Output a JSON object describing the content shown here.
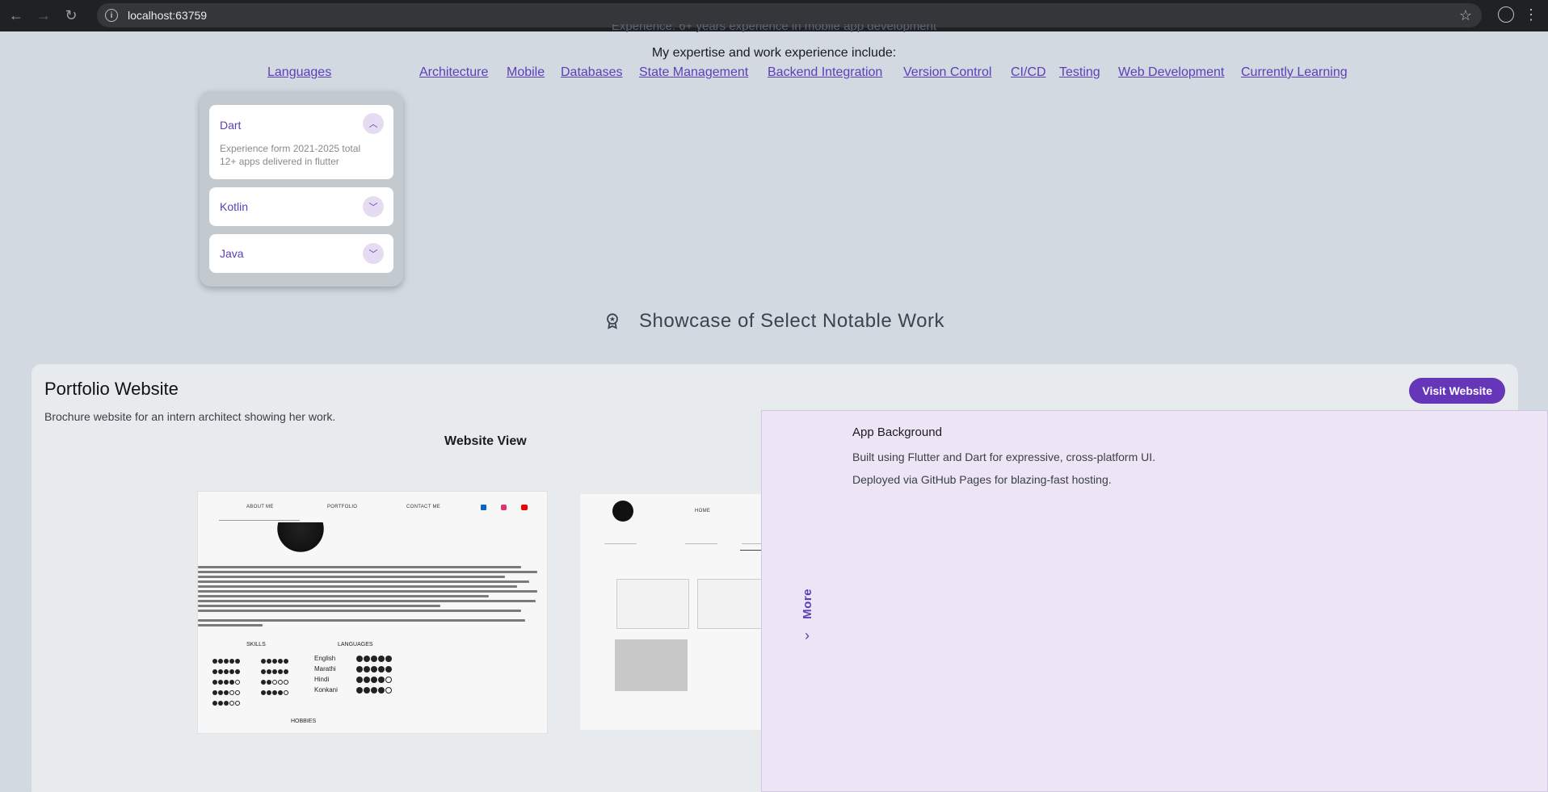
{
  "browser": {
    "url": "localhost:63759"
  },
  "intro": {
    "experience_line": "Experience: 6+ years experience in mobile app development",
    "expertise_heading": "My expertise and work experience include:"
  },
  "skills_tabs": [
    "Languages",
    "Architecture",
    "Mobile",
    "Databases",
    "State Management",
    "Backend Integration",
    "Version Control",
    "CI/CD",
    "Testing",
    "Web Development",
    "Currently Learning"
  ],
  "languages": [
    {
      "name": "Dart",
      "expanded": true,
      "details": [
        "Experience form 2021-2025 total",
        "12+ apps delivered in flutter"
      ]
    },
    {
      "name": "Kotlin",
      "expanded": false
    },
    {
      "name": "Java",
      "expanded": false
    }
  ],
  "showcase": {
    "heading": "Showcase of Select Notable Work",
    "icon": "medal-icon"
  },
  "project": {
    "title": "Portfolio Website",
    "description": "Brochure website for an intern architect showing her work.",
    "visit_label": "Visit Website",
    "website_view_label": "Website View",
    "preview1": {
      "nav": [
        "ABOUT ME",
        "PORTFOLIO",
        "CONTACT ME"
      ],
      "skills_label": "SKILLS",
      "languages_label": "LANGUAGES",
      "hobbies_label": "HOBBIES",
      "languages": [
        {
          "name": "English",
          "level": 5
        },
        {
          "name": "Marathi",
          "level": 5
        },
        {
          "name": "Hindi",
          "level": 4
        },
        {
          "name": "Konkani",
          "level": 4
        }
      ]
    },
    "preview2": {
      "nav": [
        "HOME"
      ]
    }
  },
  "side_panel": {
    "more_label": "More",
    "heading": "App Background",
    "line1": "Built using Flutter and Dart for expressive, cross-platform UI.",
    "line2": "Deployed via GitHub Pages for blazing-fast hosting."
  },
  "colors": {
    "accent": "#5b3fb7",
    "button": "#6536b8",
    "page_bg": "#d2d9e0",
    "panel_bg": "#ede5f5"
  }
}
